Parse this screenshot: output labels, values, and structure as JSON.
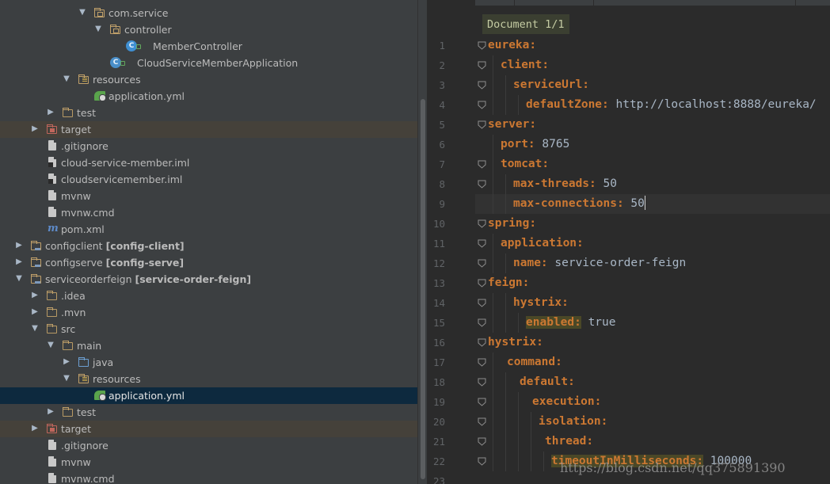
{
  "tree": {
    "rows": [
      {
        "label": "com.service",
        "module": ""
      },
      {
        "label": "controller",
        "module": ""
      },
      {
        "label": "MemberController",
        "module": ""
      },
      {
        "label": "CloudServiceMemberApplication",
        "module": ""
      },
      {
        "label": "resources",
        "module": ""
      },
      {
        "label": "application.yml",
        "module": ""
      },
      {
        "label": "test",
        "module": ""
      },
      {
        "label": "target",
        "module": ""
      },
      {
        "label": ".gitignore",
        "module": ""
      },
      {
        "label": "cloud-service-member.iml",
        "module": ""
      },
      {
        "label": "cloudservicemember.iml",
        "module": ""
      },
      {
        "label": "mvnw",
        "module": ""
      },
      {
        "label": "mvnw.cmd",
        "module": ""
      },
      {
        "label": "pom.xml",
        "module": ""
      },
      {
        "label": "configclient",
        "module": "[config-client]"
      },
      {
        "label": "configserve",
        "module": "[config-serve]"
      },
      {
        "label": "serviceorderfeign",
        "module": "[service-order-feign]"
      },
      {
        "label": ".idea",
        "module": ""
      },
      {
        "label": ".mvn",
        "module": ""
      },
      {
        "label": "src",
        "module": ""
      },
      {
        "label": "main",
        "module": ""
      },
      {
        "label": "java",
        "module": ""
      },
      {
        "label": "resources",
        "module": ""
      },
      {
        "label": "application.yml",
        "module": ""
      },
      {
        "label": "test",
        "module": ""
      },
      {
        "label": "target",
        "module": ""
      },
      {
        "label": ".gitignore",
        "module": ""
      },
      {
        "label": "mvnw",
        "module": ""
      },
      {
        "label": "mvnw.cmd",
        "module": ""
      }
    ]
  },
  "editor": {
    "badge": "Document 1/1",
    "lines": [
      {
        "n": "1",
        "key": "eureka:",
        "value": ""
      },
      {
        "n": "2",
        "key": "client:",
        "value": ""
      },
      {
        "n": "3",
        "key": "serviceUrl:",
        "value": ""
      },
      {
        "n": "4",
        "key": "defaultZone:",
        "value": " http://localhost:8888/eureka/"
      },
      {
        "n": "5",
        "key": "server:",
        "value": ""
      },
      {
        "n": "6",
        "key": "port:",
        "value": " 8765"
      },
      {
        "n": "7",
        "key": "tomcat:",
        "value": ""
      },
      {
        "n": "8",
        "key": "max-threads:",
        "value": " 50"
      },
      {
        "n": "9",
        "key": "max-connections:",
        "value": " 50"
      },
      {
        "n": "10",
        "key": "spring:",
        "value": ""
      },
      {
        "n": "11",
        "key": "application:",
        "value": ""
      },
      {
        "n": "12",
        "key": "name:",
        "value": " service-order-feign"
      },
      {
        "n": "13",
        "key": "feign:",
        "value": ""
      },
      {
        "n": "14",
        "key": "hystrix:",
        "value": ""
      },
      {
        "n": "15",
        "key": "enabled:",
        "value": " true"
      },
      {
        "n": "16",
        "key": "hystrix:",
        "value": ""
      },
      {
        "n": "17",
        "key": "command:",
        "value": ""
      },
      {
        "n": "18",
        "key": "default:",
        "value": ""
      },
      {
        "n": "19",
        "key": "execution:",
        "value": ""
      },
      {
        "n": "20",
        "key": "isolation:",
        "value": ""
      },
      {
        "n": "21",
        "key": "thread:",
        "value": ""
      },
      {
        "n": "22",
        "key": "timeoutInMilliseconds:",
        "value": " 100000"
      },
      {
        "n": "23",
        "key": "",
        "value": ""
      }
    ]
  },
  "watermark": "https://blog.csdn.net/qq375891390",
  "colors": {
    "tree_bg": "#3c3f41",
    "editor_bg": "#2b2b2b",
    "yaml_key": "#cc7832",
    "yaml_value": "#a9b7c6",
    "selection": "#0d293e"
  }
}
